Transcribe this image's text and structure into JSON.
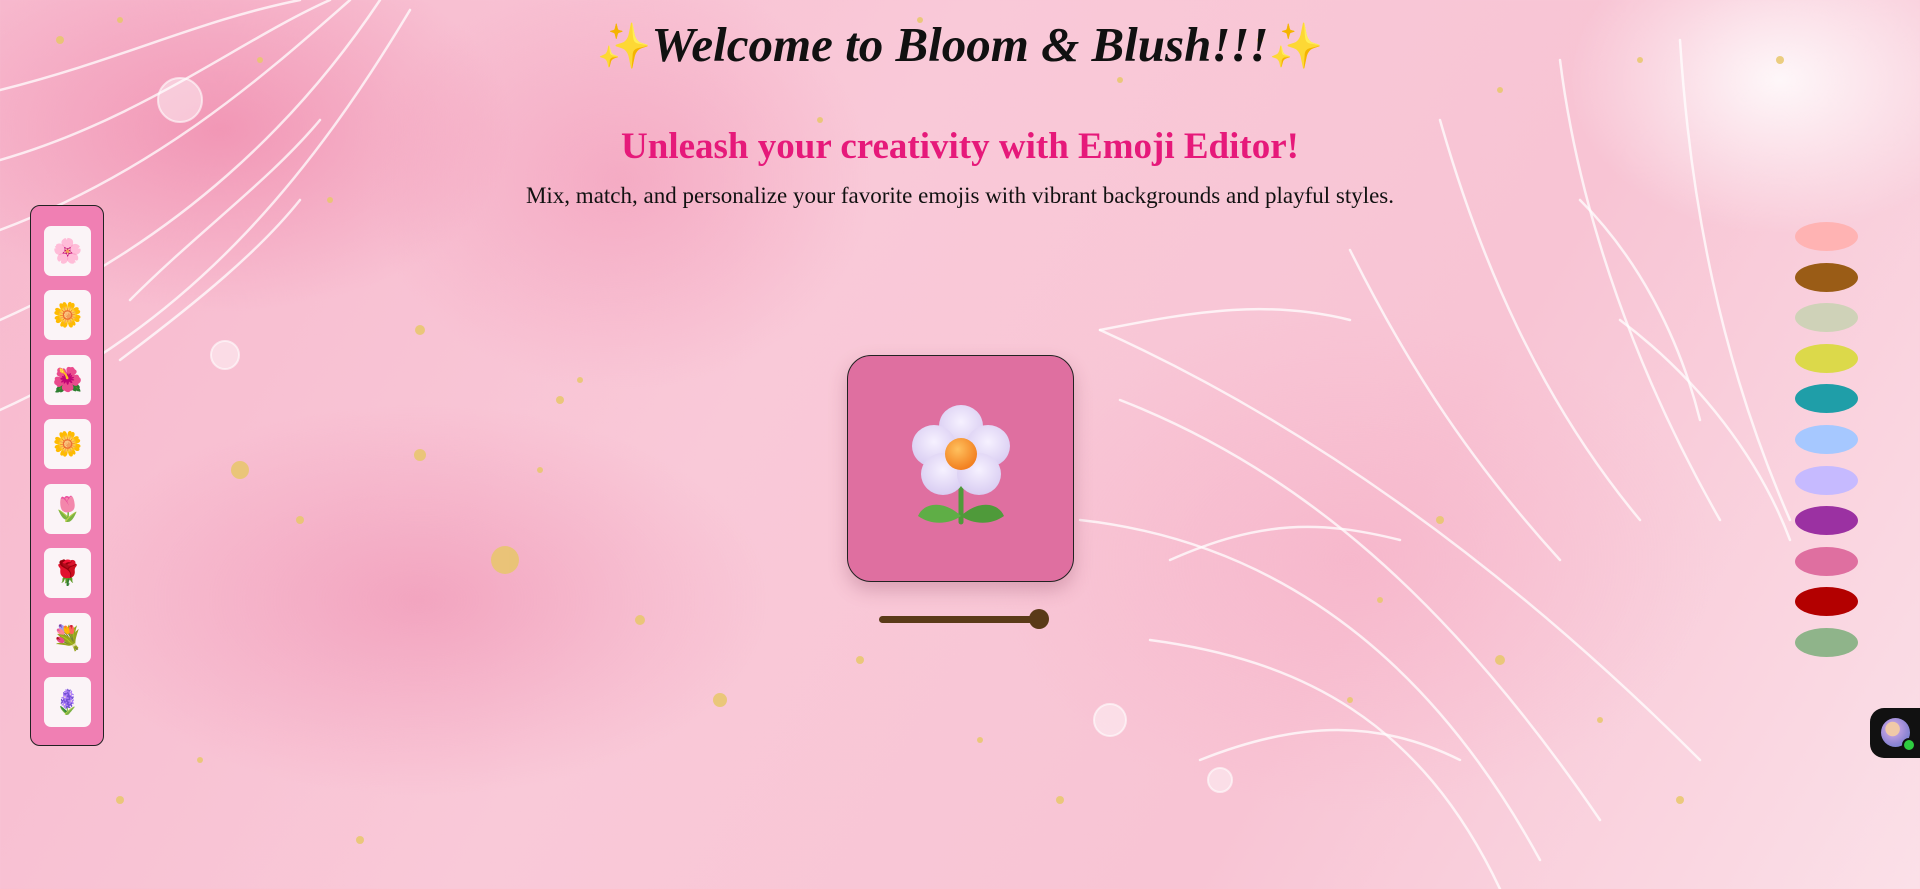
{
  "header": {
    "title": "Welcome to Bloom & Blush!!!",
    "sparkle_left": "✨",
    "sparkle_right": "✨",
    "subtitle": "Unleash your creativity with Emoji Editor!",
    "tagline": "Mix, match, and personalize your favorite emojis with vibrant backgrounds and playful styles."
  },
  "emoji_tray": {
    "items": [
      {
        "emoji": "🌸",
        "name": "cherry-blossom"
      },
      {
        "emoji": "🌼",
        "name": "blossom"
      },
      {
        "emoji": "🌺",
        "name": "hibiscus"
      },
      {
        "emoji": "🌼",
        "name": "white-flower"
      },
      {
        "emoji": "🌷",
        "name": "tulip"
      },
      {
        "emoji": "🌹",
        "name": "rose"
      },
      {
        "emoji": "💐",
        "name": "bouquet"
      },
      {
        "emoji": "🪻",
        "name": "hyacinth"
      }
    ]
  },
  "canvas": {
    "background_color": "#df6fa0",
    "emoji_name": "white-daisy"
  },
  "size_slider": {
    "value": 1.0,
    "fill_color": "#5a3a18"
  },
  "palette": {
    "colors": [
      "#ffb3b3",
      "#9a5c16",
      "#cfd2b8",
      "#dcd94a",
      "#1f9ea8",
      "#a6c8ff",
      "#c6baff",
      "#9b31a2",
      "#df6fa0",
      "#b30000",
      "#8fb48a"
    ]
  },
  "colors": {
    "title": "#111111",
    "subtitle": "#e6197a",
    "tray_bg": "#f07fb3"
  }
}
